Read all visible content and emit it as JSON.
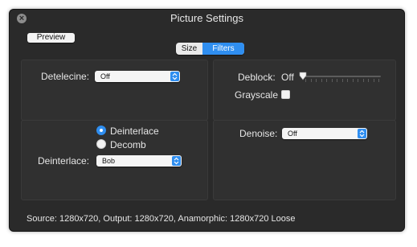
{
  "window": {
    "title": "Picture Settings"
  },
  "toolbar": {
    "preview_label": "Preview",
    "tabs": [
      {
        "label": "Size",
        "selected": false
      },
      {
        "label": "Filters",
        "selected": true
      }
    ]
  },
  "filters": {
    "detelecine": {
      "label": "Detelecine:",
      "value": "Off"
    },
    "deblock": {
      "label": "Deblock:",
      "value": "Off",
      "slider_level": 0
    },
    "grayscale": {
      "label": "Grayscale",
      "checked": false
    },
    "deinterlace_mode": {
      "options": [
        {
          "label": "Deinterlace",
          "selected": true
        },
        {
          "label": "Decomb",
          "selected": false
        }
      ]
    },
    "deinterlace": {
      "label": "Deinterlace:",
      "value": "Bob"
    },
    "denoise": {
      "label": "Denoise:",
      "value": "Off"
    }
  },
  "status": {
    "text": "Source: 1280x720, Output: 1280x720, Anamorphic: 1280x720 Loose"
  },
  "colors": {
    "accent": "#2f8ef0",
    "window_bg": "#2a2a2a",
    "panel_bg": "#303030"
  }
}
